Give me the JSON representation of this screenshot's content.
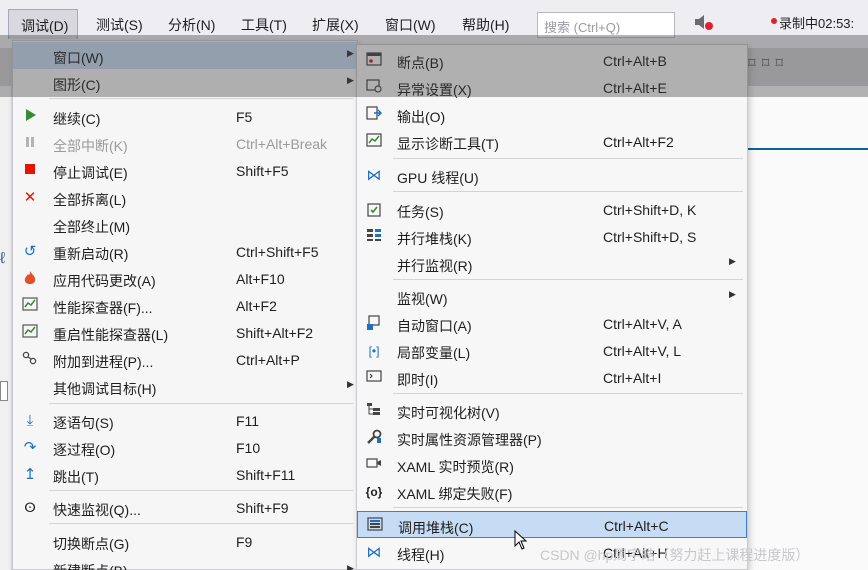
{
  "menubar": {
    "items": [
      "调试(D)",
      "测试(S)",
      "分析(N)",
      "工具(T)",
      "扩展(X)",
      "窗口(W)",
      "帮助(H)"
    ],
    "search_placeholder": "搜索 (Ctrl+Q)",
    "recording": "录制中02:53:"
  },
  "debug_menu": {
    "items": [
      {
        "label": "窗口(W)",
        "shortcut": "",
        "icon": "none"
      },
      {
        "label": "图形(C)",
        "shortcut": "",
        "icon": "none"
      },
      {
        "label": "继续(C)",
        "shortcut": "F5",
        "icon": "play-icon"
      },
      {
        "label": "全部中断(K)",
        "shortcut": "Ctrl+Alt+Break",
        "icon": "pause-icon"
      },
      {
        "label": "停止调试(E)",
        "shortcut": "Shift+F5",
        "icon": "stop-icon"
      },
      {
        "label": "全部拆离(L)",
        "shortcut": "",
        "icon": "close-icon"
      },
      {
        "label": "全部终止(M)",
        "shortcut": "",
        "icon": "none"
      },
      {
        "label": "重新启动(R)",
        "shortcut": "Ctrl+Shift+F5",
        "icon": "restart-icon"
      },
      {
        "label": "应用代码更改(A)",
        "shortcut": "Alt+F10",
        "icon": "hot-reload-icon"
      },
      {
        "label": "性能探查器(F)...",
        "shortcut": "Alt+F2",
        "icon": "profiler-icon"
      },
      {
        "label": "重启性能探查器(L)",
        "shortcut": "Shift+Alt+F2",
        "icon": "profiler-restart-icon"
      },
      {
        "label": "附加到进程(P)...",
        "shortcut": "Ctrl+Alt+P",
        "icon": "attach-process-icon"
      },
      {
        "label": "其他调试目标(H)",
        "shortcut": "",
        "icon": "none"
      },
      {
        "label": "逐语句(S)",
        "shortcut": "F11",
        "icon": "step-into-icon"
      },
      {
        "label": "逐过程(O)",
        "shortcut": "F10",
        "icon": "step-over-icon"
      },
      {
        "label": "跳出(T)",
        "shortcut": "Shift+F11",
        "icon": "step-out-icon"
      },
      {
        "label": "快速监视(Q)...",
        "shortcut": "Shift+F9",
        "icon": "quickwatch-icon"
      },
      {
        "label": "切换断点(G)",
        "shortcut": "F9",
        "icon": "none"
      },
      {
        "label": "新建断点(B)",
        "shortcut": "",
        "icon": "none"
      }
    ]
  },
  "window_menu": {
    "items": [
      {
        "label": "断点(B)",
        "shortcut": "Ctrl+Alt+B",
        "icon": "breakpoints-icon"
      },
      {
        "label": "异常设置(X)",
        "shortcut": "Ctrl+Alt+E",
        "icon": "exception-settings-icon"
      },
      {
        "label": "输出(O)",
        "shortcut": "",
        "icon": "output-icon"
      },
      {
        "label": "显示诊断工具(T)",
        "shortcut": "Ctrl+Alt+F2",
        "icon": "diagnostics-icon"
      },
      {
        "label": "GPU 线程(U)",
        "shortcut": "",
        "icon": "gpu-threads-icon"
      },
      {
        "label": "任务(S)",
        "shortcut": "Ctrl+Shift+D, K",
        "icon": "tasks-icon"
      },
      {
        "label": "并行堆栈(K)",
        "shortcut": "Ctrl+Shift+D, S",
        "icon": "parallel-stacks-icon"
      },
      {
        "label": "并行监视(R)",
        "shortcut": "",
        "icon": "none"
      },
      {
        "label": "监视(W)",
        "shortcut": "",
        "icon": "none"
      },
      {
        "label": "自动窗口(A)",
        "shortcut": "Ctrl+Alt+V, A",
        "icon": "autos-icon"
      },
      {
        "label": "局部变量(L)",
        "shortcut": "Ctrl+Alt+V, L",
        "icon": "locals-icon"
      },
      {
        "label": "即时(I)",
        "shortcut": "Ctrl+Alt+I",
        "icon": "immediate-icon"
      },
      {
        "label": "实时可视化树(V)",
        "shortcut": "",
        "icon": "live-visual-tree-icon"
      },
      {
        "label": "实时属性资源管理器(P)",
        "shortcut": "",
        "icon": "live-property-explorer-icon"
      },
      {
        "label": "XAML 实时预览(R)",
        "shortcut": "",
        "icon": "xaml-preview-icon"
      },
      {
        "label": "XAML 绑定失败(F)",
        "shortcut": "",
        "icon": "xaml-binding-icon"
      },
      {
        "label": "调用堆栈(C)",
        "shortcut": "Ctrl+Alt+C",
        "icon": "call-stack-icon"
      },
      {
        "label": "线程(H)",
        "shortcut": "Ctrl+Alt+H",
        "icon": "threads-icon"
      }
    ]
  },
  "watermark": "CSDN @hp周宇皓（努力赶上课程进度版）",
  "colors": {
    "selection": "#c6dcf4",
    "selection_border": "#3b7fd0",
    "accent_blue": "#0e639c",
    "stop_red": "#e51400",
    "play_green": "#388a34"
  }
}
